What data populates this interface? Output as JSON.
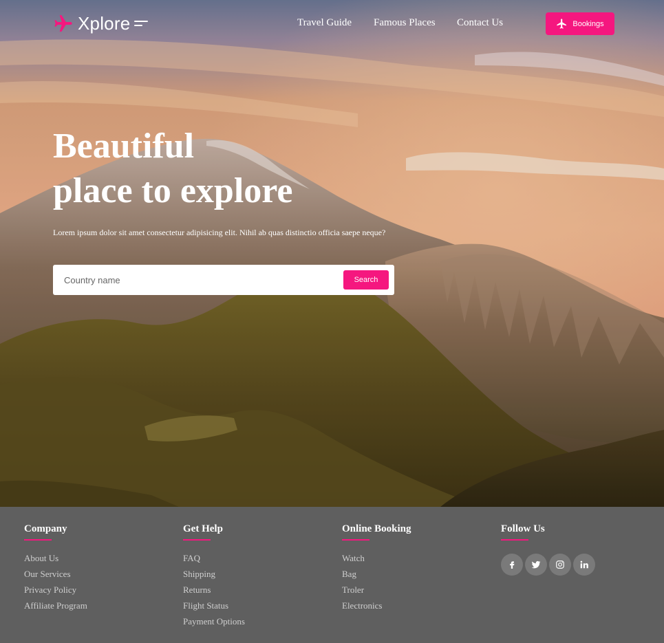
{
  "brand": {
    "name": "Xplore",
    "accent": "#f5177f"
  },
  "nav": {
    "links": [
      "Travel Guide",
      "Famous Places",
      "Contact Us"
    ],
    "bookings_label": "Bookings"
  },
  "hero": {
    "title_line1": "Beautiful",
    "title_line2": "place to explore",
    "subtitle": "Lorem ipsum dolor sit amet consectetur adipisicing elit. Nihil ab quas distinctio officia saepe neque?",
    "search": {
      "placeholder": "Country name",
      "value": "",
      "button": "Search"
    }
  },
  "footer": {
    "columns": [
      {
        "title": "Company",
        "items": [
          "About Us",
          "Our Services",
          "Privacy Policy",
          "Affiliate Program"
        ]
      },
      {
        "title": "Get Help",
        "items": [
          "FAQ",
          "Shipping",
          "Returns",
          "Flight Status",
          "Payment Options"
        ]
      },
      {
        "title": "Online Booking",
        "items": [
          "Watch",
          "Bag",
          "Troler",
          "Electronics"
        ]
      }
    ],
    "follow": {
      "title": "Follow Us",
      "icons": [
        "facebook-icon",
        "twitter-icon",
        "instagram-icon",
        "linkedin-icon"
      ]
    }
  }
}
